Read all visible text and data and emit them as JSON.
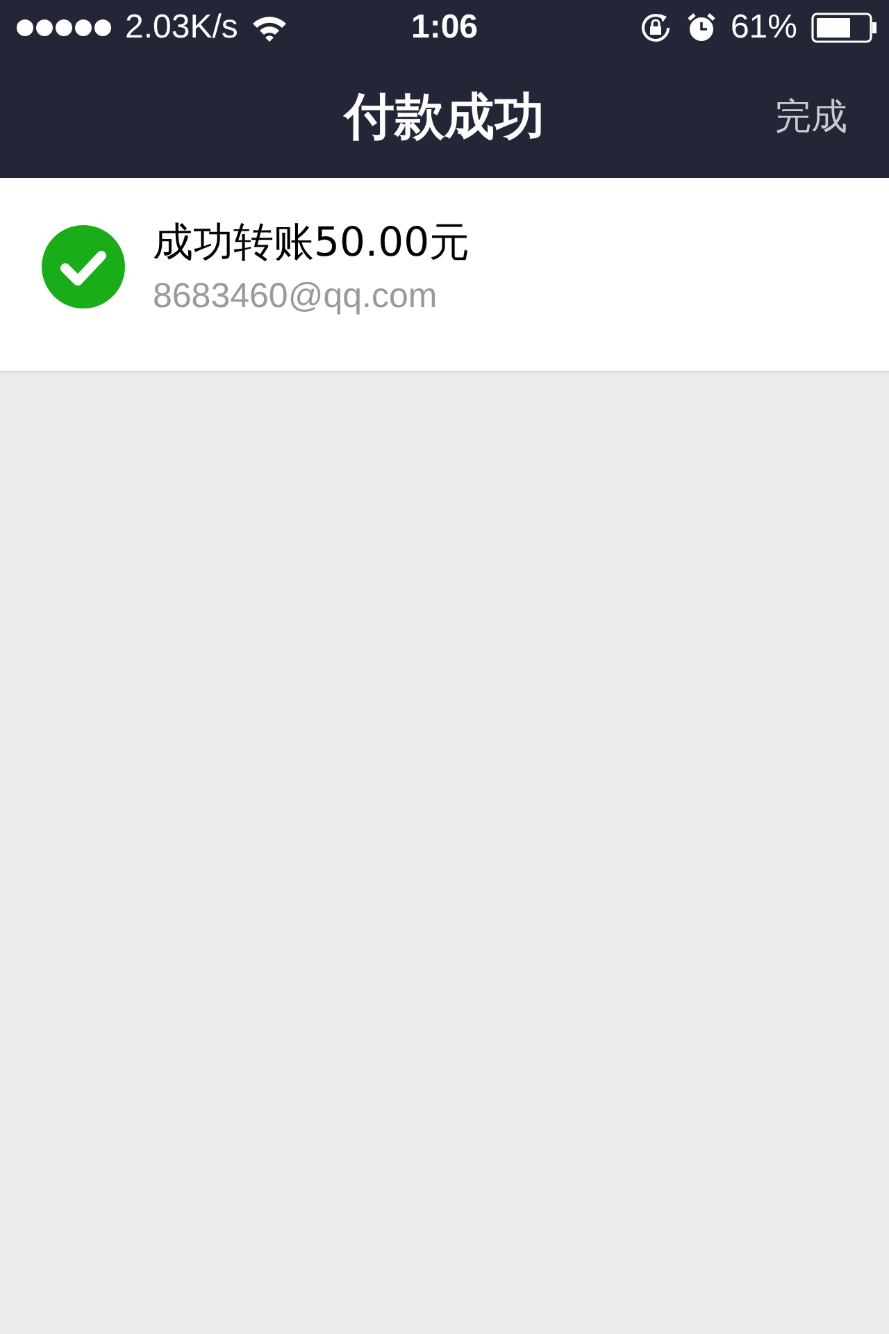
{
  "status_bar": {
    "speed": "2.03K/s",
    "time": "1:06",
    "battery": "61%"
  },
  "nav": {
    "title": "付款成功",
    "done": "完成"
  },
  "result": {
    "title": "成功转账50.00元",
    "account": "8683460@qq.com"
  }
}
